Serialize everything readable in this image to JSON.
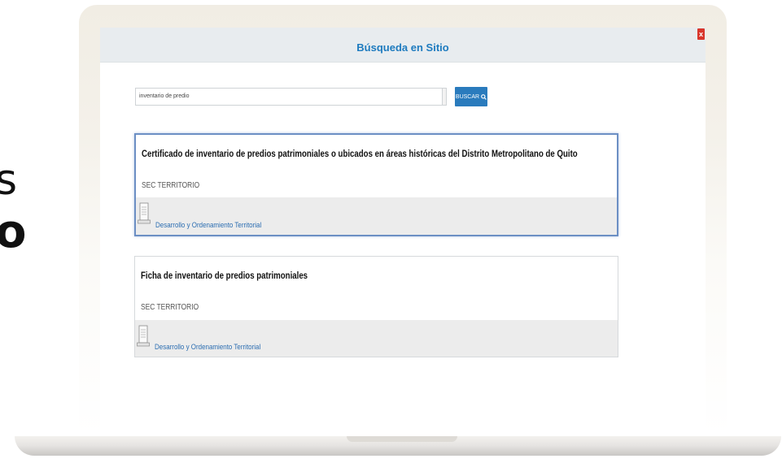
{
  "background_fragments": [
    "s",
    "o"
  ],
  "dialog": {
    "title": "Búsqueda en Sitio",
    "close_label": "x"
  },
  "search": {
    "value": "inventario de predio",
    "button_label": "BUSCAR"
  },
  "results": [
    {
      "title": "Certificado de inventario de predios patrimoniales o ubicados en áreas históricas del Distrito Metropolitano de Quito",
      "subtitle": "SEC TERRITORIO",
      "category": "Desarrollo y Ordenamiento Territorial"
    },
    {
      "title": "Ficha de inventario de predios patrimoniales",
      "subtitle": "SEC TERRITORIO",
      "category": "Desarrollo y Ordenamiento Territorial"
    }
  ],
  "colors": {
    "accent": "#2a7bbd",
    "title": "#1e7bbf",
    "close": "#d9362b",
    "highlight_border": "#6c8fc4"
  },
  "icons": {
    "search_button": "search-icon",
    "result_item": "document-icon",
    "close": "close-icon"
  }
}
